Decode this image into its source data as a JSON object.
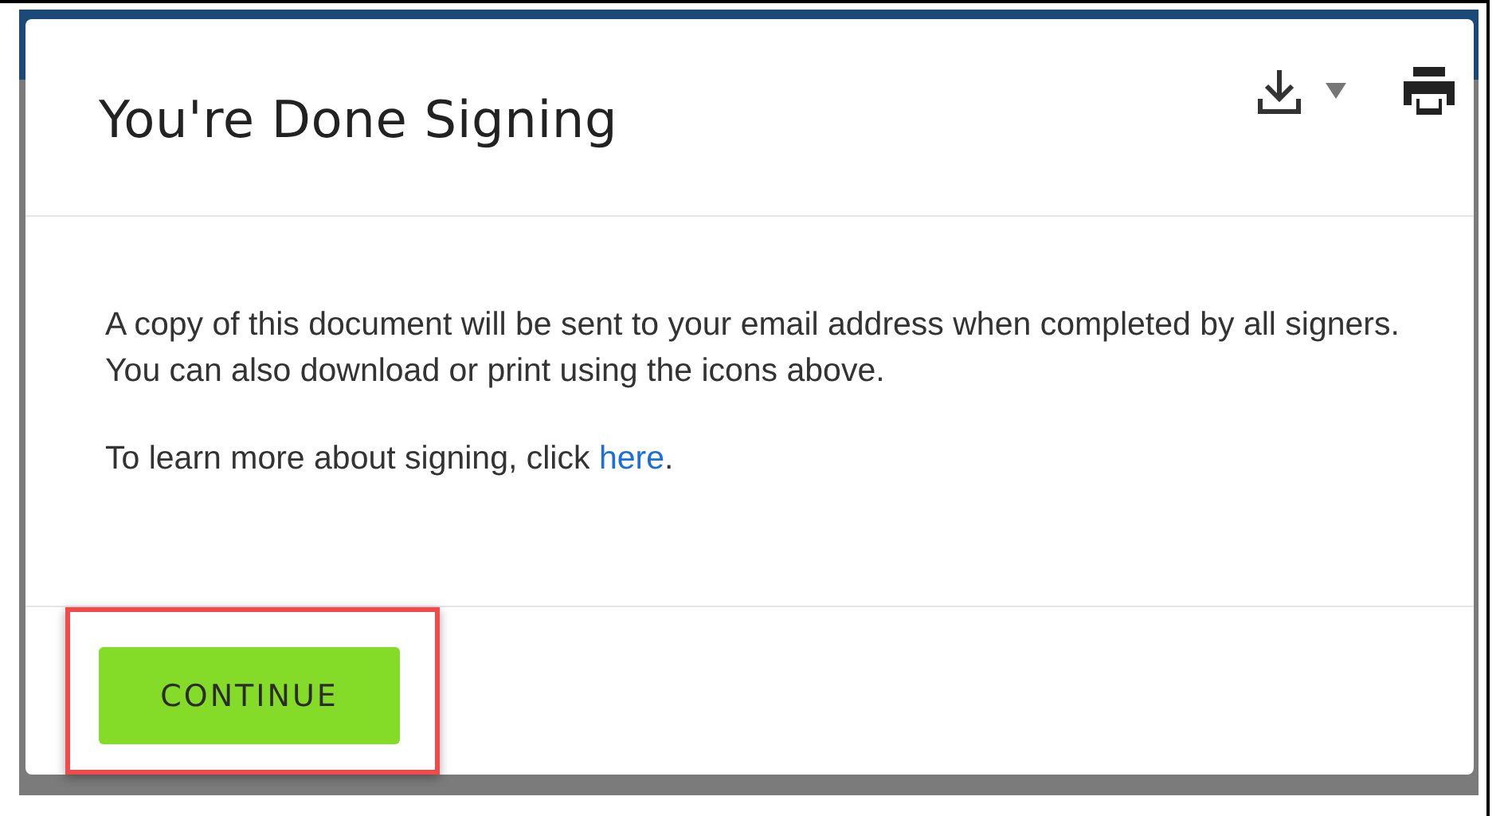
{
  "dialog": {
    "title": "You're Done Signing",
    "message": "A copy of this document will be sent to your email address when completed by all signers. You can also download or print using the icons above.",
    "help": {
      "before": "To learn more about signing, click ",
      "link": "here",
      "after": "."
    },
    "button": {
      "label": "CONTINUE",
      "highlighted": true
    }
  }
}
